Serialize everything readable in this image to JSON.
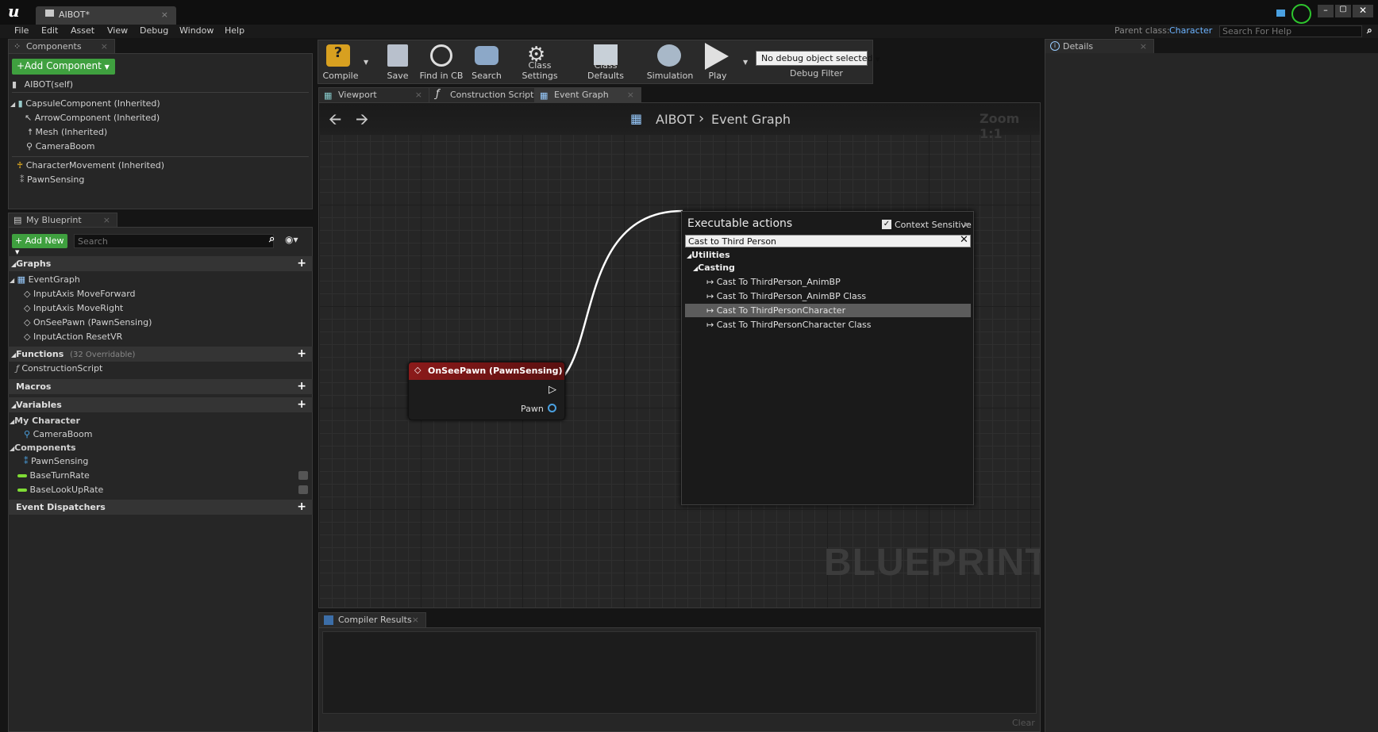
{
  "app": {
    "logo": "u",
    "tab_title": "AIBOT*",
    "parent_class_label": "Parent class:",
    "parent_class_value": "Character",
    "help_search_placeholder": "Search For Help"
  },
  "menu": [
    "File",
    "Edit",
    "Asset",
    "View",
    "Debug",
    "Window",
    "Help"
  ],
  "components_panel": {
    "tab_label": "Components",
    "add_button": "+Add Component",
    "self_item": "AIBOT(self)",
    "items": [
      {
        "label": "CapsuleComponent (Inherited)",
        "icon": "capsule-icon"
      },
      {
        "label": "ArrowComponent (Inherited)",
        "icon": "arrow-icon"
      },
      {
        "label": "Mesh (Inherited)",
        "icon": "mesh-icon"
      },
      {
        "label": "CameraBoom",
        "icon": "camera-boom-icon"
      },
      {
        "label": "CharacterMovement (Inherited)",
        "icon": "character-movement-icon"
      },
      {
        "label": "PawnSensing",
        "icon": "pawn-sensing-icon"
      }
    ]
  },
  "my_blueprint": {
    "tab_label": "My Blueprint",
    "add_new": "+ Add New",
    "search_placeholder": "Search",
    "graphs_header": "Graphs",
    "event_graph": "EventGraph",
    "graph_events": [
      "InputAxis MoveForward",
      "InputAxis MoveRight",
      "OnSeePawn (PawnSensing)",
      "InputAction ResetVR"
    ],
    "functions_header": "Functions",
    "functions_count": "(32 Overridable)",
    "functions": [
      "ConstructionScript"
    ],
    "macros_header": "Macros",
    "variables_header": "Variables",
    "my_character_header": "My Character",
    "my_character_vars": [
      "CameraBoom"
    ],
    "components_header": "Components",
    "components_vars": [
      "PawnSensing"
    ],
    "other_vars": [
      "BaseTurnRate",
      "BaseLookUpRate"
    ],
    "event_dispatchers_header": "Event Dispatchers"
  },
  "toolbar": {
    "buttons": [
      "Compile",
      "Save",
      "Find in CB",
      "Search",
      "Class Settings",
      "Class Defaults",
      "Simulation",
      "Play"
    ],
    "debug_dropdown": "No debug object selected",
    "debug_filter_label": "Debug Filter"
  },
  "graph_tabs": [
    "Viewport",
    "Construction Script",
    "Event Graph"
  ],
  "graph": {
    "breadcrumb_root": "AIBOT",
    "breadcrumb_sep": "›",
    "breadcrumb_current": "Event Graph",
    "zoom": "Zoom 1:1",
    "watermark": "BLUEPRINT",
    "node_title": "OnSeePawn (PawnSensing)",
    "node_pin": "Pawn"
  },
  "context_menu": {
    "title": "Executable actions",
    "context_sensitive": "Context Sensitive",
    "search_value": "Cast to Third Person",
    "category_utilities": "Utilities",
    "category_casting": "Casting",
    "items": [
      "Cast To ThirdPerson_AnimBP",
      "Cast To ThirdPerson_AnimBP Class",
      "Cast To ThirdPersonCharacter",
      "Cast To ThirdPersonCharacter Class"
    ],
    "selected_index": 2
  },
  "compiler_results": {
    "tab_label": "Compiler Results",
    "clear": "Clear"
  },
  "details": {
    "tab_label": "Details"
  },
  "colors": {
    "accent_green": "#3fa03f",
    "node_red": "#8b1a1a",
    "link_blue": "#6cb3ff"
  }
}
